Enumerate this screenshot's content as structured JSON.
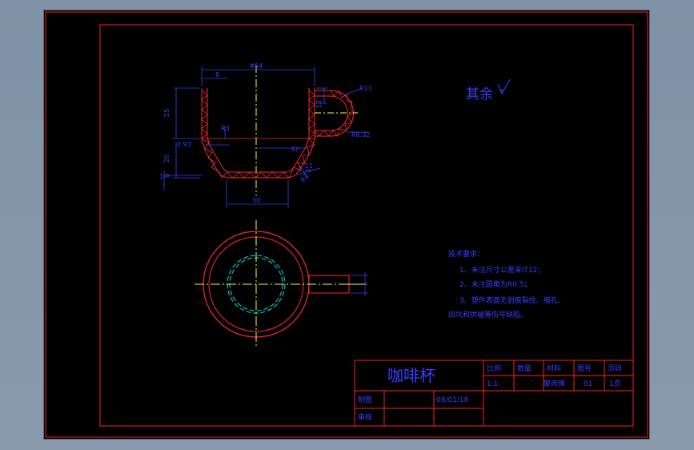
{
  "colors": {
    "frame": "#ff1f1f",
    "text": "#3d3dff",
    "dim": "#3d3dff",
    "center": "#ffff33",
    "hidden": "#00e5e5",
    "wall": "#ff2a2a",
    "background": "#000000"
  },
  "dimensions": {
    "top_dia": "Φ54",
    "inner_width": "8",
    "height_left": "25",
    "height_lower": "20",
    "bottom_step": "8",
    "offset_small": "1",
    "radius_r3": "R3",
    "wall_thk": "0.93",
    "wall_thk_top": "0.93",
    "depth_32": "32",
    "base_30": "30",
    "handle_r11": "R11",
    "handle_r8": "R8.32",
    "handle_12": "12",
    "angle_small": "11",
    "foot_dim": "R2.5"
  },
  "roughness_note": "其余",
  "tech_requirements": {
    "title": "技术要求：",
    "items": [
      "1、未注尺寸公差采IT12；",
      "2、未注圆角为R0.5；",
      "3、塑件表面无划痕裂纹、缩孔、",
      "凹坑和拱被等伤号缺陷。"
    ]
  },
  "title_block": {
    "part_name": "咖啡杯",
    "headers": [
      "比例",
      "数量",
      "材料",
      "图号",
      "页码"
    ],
    "values": [
      "1:1",
      "",
      "聚丙烯",
      "01",
      "1页"
    ],
    "drawn_label": "制图",
    "drawn_date": "08/01/18",
    "checked_label": "审核"
  }
}
